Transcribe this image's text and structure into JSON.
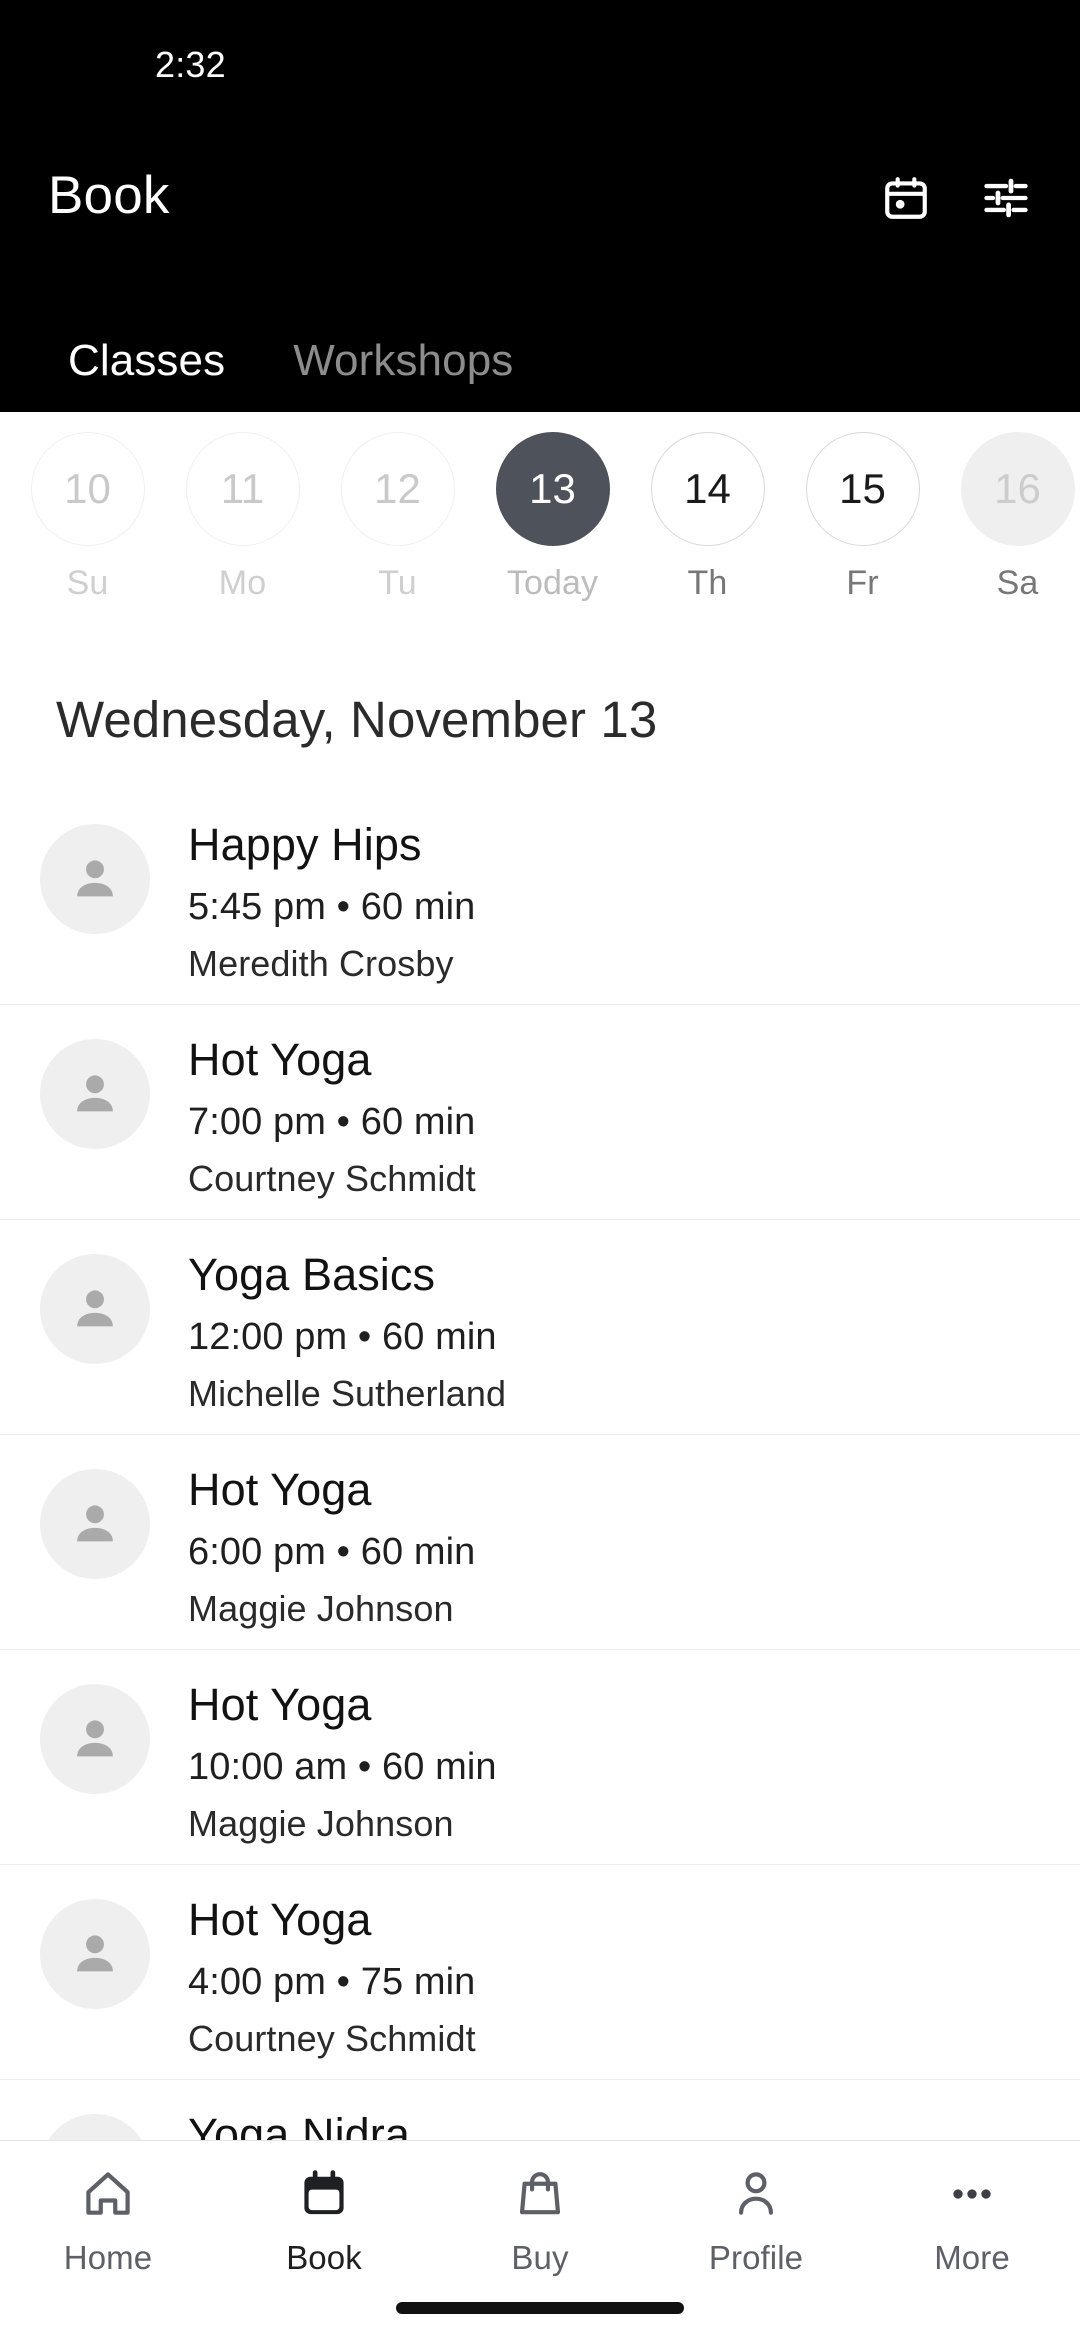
{
  "status_bar": {
    "time": "2:32"
  },
  "app_bar": {
    "title": "Book",
    "actions": [
      {
        "name": "calendar-picker-icon",
        "label": "Calendar"
      },
      {
        "name": "filter-icon",
        "label": "Filters"
      }
    ]
  },
  "tabs": [
    {
      "label": "Classes",
      "active": true
    },
    {
      "label": "Workshops",
      "active": false
    }
  ],
  "date_strip": [
    {
      "day": "10",
      "weekday": "Su",
      "state": "past"
    },
    {
      "day": "11",
      "weekday": "Mo",
      "state": "past"
    },
    {
      "day": "12",
      "weekday": "Tu",
      "state": "past"
    },
    {
      "day": "13",
      "weekday": "Today",
      "state": "selected"
    },
    {
      "day": "14",
      "weekday": "Th",
      "state": "available"
    },
    {
      "day": "15",
      "weekday": "Fr",
      "state": "available"
    },
    {
      "day": "16",
      "weekday": "Sa",
      "state": "muted"
    }
  ],
  "day_heading": "Wednesday, November 13",
  "classes": [
    {
      "name": "Happy Hips",
      "time": "5:45 pm • 60 min",
      "instructor": "Meredith Crosby"
    },
    {
      "name": "Hot Yoga",
      "time": "7:00 pm • 60 min",
      "instructor": "Courtney Schmidt"
    },
    {
      "name": "Yoga Basics",
      "time": "12:00 pm • 60 min",
      "instructor": "Michelle Sutherland"
    },
    {
      "name": "Hot Yoga",
      "time": "6:00 pm • 60 min",
      "instructor": "Maggie Johnson"
    },
    {
      "name": "Hot Yoga",
      "time": "10:00 am • 60 min",
      "instructor": "Maggie Johnson"
    },
    {
      "name": "Hot Yoga",
      "time": "4:00 pm • 75 min",
      "instructor": "Courtney Schmidt"
    },
    {
      "name": "Yoga Nidra",
      "time": "",
      "instructor": ""
    }
  ],
  "bottom_nav": [
    {
      "label": "Home",
      "icon": "home-icon",
      "active": false
    },
    {
      "label": "Book",
      "icon": "calendar-icon",
      "active": true
    },
    {
      "label": "Buy",
      "icon": "bag-icon",
      "active": false
    },
    {
      "label": "Profile",
      "icon": "person-icon",
      "active": false
    },
    {
      "label": "More",
      "icon": "more-icon",
      "active": false
    }
  ],
  "colors": {
    "app_bar_background": "#000000",
    "selected_date": "#4e525b",
    "page_background": "#ffffff",
    "divider": "#ededed",
    "avatar_background": "#efefef",
    "avatar_glyph": "#aaaaaa"
  }
}
